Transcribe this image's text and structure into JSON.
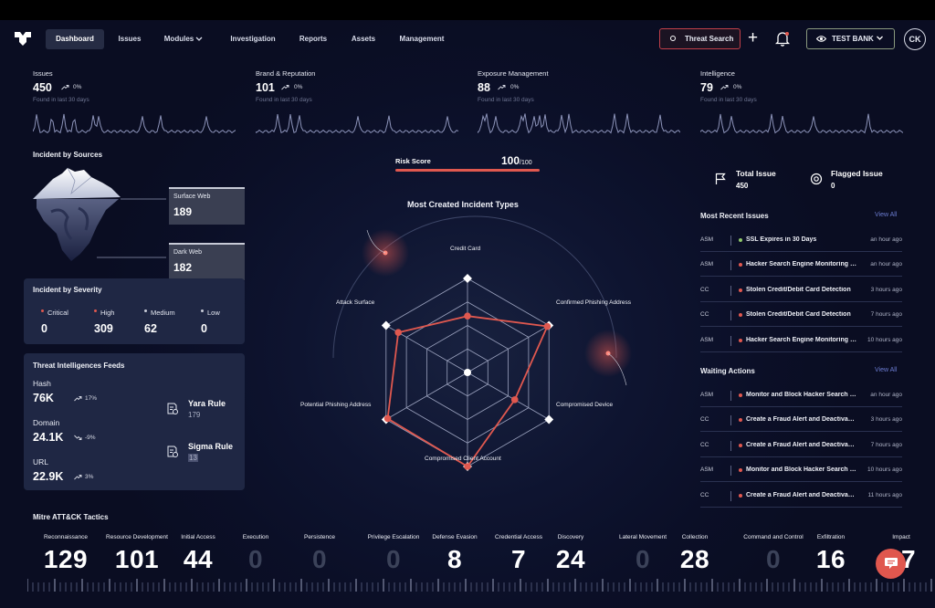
{
  "nav": {
    "tabs": [
      "Dashboard",
      "Issues",
      "Modules",
      "Investigation",
      "Reports",
      "Assets",
      "Management"
    ],
    "threat_search": "Threat Search",
    "org": "TEST BANK",
    "avatar": "CK"
  },
  "kpis": [
    {
      "title": "Issues",
      "value": "450",
      "change": "0%",
      "sub": "Found in last 30 days"
    },
    {
      "title": "Brand & Reputation",
      "value": "101",
      "change": "0%",
      "sub": "Found in last 30 days"
    },
    {
      "title": "Exposure Management",
      "value": "88",
      "change": "0%",
      "sub": "Found in last 30 days"
    },
    {
      "title": "Intelligence",
      "value": "79",
      "change": "0%",
      "sub": "Found in last 30 days"
    }
  ],
  "sources": {
    "title": "Incident by Sources",
    "surface": {
      "label": "Surface Web",
      "value": "189"
    },
    "dark": {
      "label": "Dark Web",
      "value": "182"
    }
  },
  "severity": {
    "title": "Incident by Severity",
    "items": [
      {
        "label": "Critical",
        "value": "0",
        "color": "#e0584f"
      },
      {
        "label": "High",
        "value": "309",
        "color": "#e0584f"
      },
      {
        "label": "Medium",
        "value": "62",
        "color": "#c9ccd8"
      },
      {
        "label": "Low",
        "value": "0",
        "color": "#c9ccd8"
      }
    ]
  },
  "feeds": {
    "title": "Threat Intelligences Feeds",
    "hash": {
      "label": "Hash",
      "value": "76K",
      "change": "17%"
    },
    "domain": {
      "label": "Domain",
      "value": "24.1K",
      "change": "-9%"
    },
    "url": {
      "label": "URL",
      "value": "22.9K",
      "change": "3%"
    },
    "yara": {
      "label": "Yara Rule",
      "value": "179"
    },
    "sigma": {
      "label": "Sigma Rule",
      "value": "13"
    }
  },
  "risk": {
    "label": "Risk Score",
    "value": "100",
    "max": "/100"
  },
  "radar": {
    "title": "Most Created Incident Types",
    "axes": [
      "Credit Card",
      "Confirmed Phishing Address",
      "Compromised Device",
      "Compromised Client Account",
      "Potential Phishing Address",
      "Attack Surface"
    ],
    "values": [
      0.6,
      0.98,
      0.58,
      1.0,
      0.98,
      0.85
    ]
  },
  "stats": {
    "total_issue": {
      "label": "Total Issue",
      "value": "450"
    },
    "flagged_issue": {
      "label": "Flagged Issue",
      "value": "0"
    }
  },
  "recent": {
    "title": "Most Recent Issues",
    "view_all": "View All",
    "rows": [
      {
        "src": "ASM",
        "text": "SSL Expires in 30 Days",
        "time": "an hour ago",
        "color": "#8fc76a"
      },
      {
        "src": "ASM",
        "text": "Hacker Search Engine Monitoring …",
        "time": "an hour ago",
        "color": "#e0584f"
      },
      {
        "src": "CC",
        "text": "Stolen Credit/Debit Card Detection",
        "time": "3 hours ago",
        "color": "#e0584f"
      },
      {
        "src": "CC",
        "text": "Stolen Credit/Debit Card Detection",
        "time": "7 hours ago",
        "color": "#e0584f"
      },
      {
        "src": "ASM",
        "text": "Hacker Search Engine Monitoring …",
        "time": "10 hours ago",
        "color": "#e0584f"
      }
    ]
  },
  "waiting": {
    "title": "Waiting Actions",
    "view_all": "View All",
    "rows": [
      {
        "src": "ASM",
        "text": "Monitor and Block Hacker Search …",
        "time": "an hour ago",
        "color": "#e0584f"
      },
      {
        "src": "CC",
        "text": "Create a Fraud Alert and Deactiva…",
        "time": "3 hours ago",
        "color": "#e0584f"
      },
      {
        "src": "CC",
        "text": "Create a Fraud Alert and Deactiva…",
        "time": "7 hours ago",
        "color": "#e0584f"
      },
      {
        "src": "ASM",
        "text": "Monitor and Block Hacker Search …",
        "time": "10 hours ago",
        "color": "#e0584f"
      },
      {
        "src": "CC",
        "text": "Create a Fraud Alert and Deactiva…",
        "time": "11 hours ago",
        "color": "#e0584f"
      }
    ]
  },
  "mitre": {
    "title": "Mitre ATT&CK Tactics",
    "items": [
      {
        "label": "Reconnaissance",
        "value": "129"
      },
      {
        "label": "Resource Development",
        "value": "101"
      },
      {
        "label": "Initial Access",
        "value": "44"
      },
      {
        "label": "Execution",
        "value": "0"
      },
      {
        "label": "Persistence",
        "value": "0"
      },
      {
        "label": "Privilege Escalation",
        "value": "0"
      },
      {
        "label": "Defense Evasion",
        "value": "8"
      },
      {
        "label": "Credential Access",
        "value": "7"
      },
      {
        "label": "Discovery",
        "value": "24"
      },
      {
        "label": "Lateral Movement",
        "value": "0"
      },
      {
        "label": "Collection",
        "value": "28"
      },
      {
        "label": "Command and Control",
        "value": "0"
      },
      {
        "label": "Exfiltration",
        "value": "16"
      },
      {
        "label": "Impact",
        "value": "17"
      }
    ]
  }
}
